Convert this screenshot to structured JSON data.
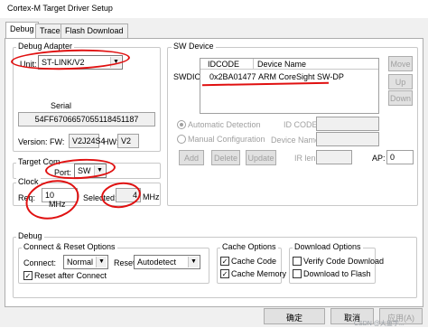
{
  "window": {
    "title": "Cortex-M Target Driver Setup"
  },
  "tabs": [
    {
      "label": "Debug",
      "active": true
    },
    {
      "label": "Trace",
      "active": false
    },
    {
      "label": "Flash Download",
      "active": false
    }
  ],
  "debug_adapter": {
    "legend": "Debug Adapter",
    "unit_label": "Unit:",
    "unit_value": "ST-LINK/V2",
    "serial_label": "Serial",
    "serial_value": "54FF6706657055118451187",
    "version_label": "Version: FW:",
    "fw_value": "V2J24S4",
    "hw_label": "HW:",
    "hw_value": "V2"
  },
  "target_com": {
    "legend": "Target Com",
    "port_label": "Port:",
    "port_value": "SW"
  },
  "clock": {
    "legend": "Clock",
    "req_label": "Req:",
    "req_value": "10",
    "req_unit": "MHz",
    "selected_label": "Selected:",
    "selected_value": "4",
    "selected_unit": "MHz"
  },
  "sw_device": {
    "legend": "SW Device",
    "row_label": "SWDIO",
    "columns": [
      "IDCODE",
      "Device Name"
    ],
    "rows": [
      {
        "idcode": "0x2BA01477",
        "device_name": "ARM CoreSight SW-DP"
      }
    ],
    "buttons": {
      "move": "Move",
      "up": "Up",
      "down": "Down"
    },
    "automatic_detection": "Automatic Detection",
    "manual_configuration": "Manual Configuration",
    "id_code_label": "ID CODE:",
    "device_name_label": "Device Name:",
    "ir_len_label": "IR len:",
    "ap_label": "AP:",
    "ap_value": "0",
    "add": "Add",
    "delete": "Delete",
    "update": "Update"
  },
  "debug": {
    "legend": "Debug",
    "connect_reset_legend": "Connect & Reset Options",
    "connect_label": "Connect:",
    "connect_value": "Normal",
    "reset_label": "Reset:",
    "reset_value": "Autodetect",
    "reset_after_connect": "Reset after Connect",
    "cache_legend": "Cache Options",
    "cache_code": "Cache Code",
    "cache_memory": "Cache Memory",
    "download_legend": "Download Options",
    "verify_code_download": "Verify Code Download",
    "download_to_flash": "Download to Flash"
  },
  "dialog_buttons": {
    "ok": "确定",
    "cancel": "取消",
    "apply": "应用(A)"
  },
  "watermark": "CSDN @大鱼学...",
  "annotation_color": "#e01010"
}
